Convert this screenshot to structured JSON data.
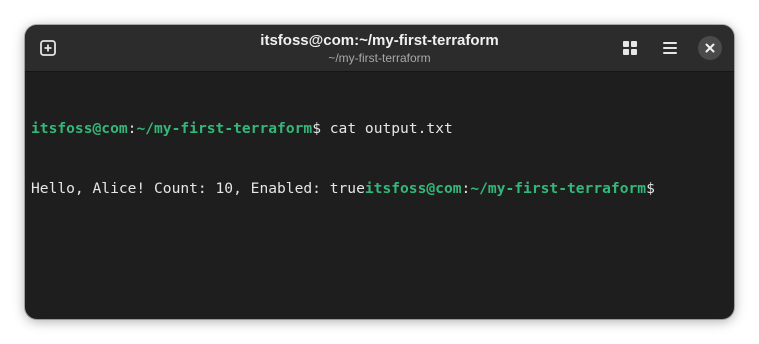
{
  "window": {
    "title": "itsfoss@com:~/my-first-terraform",
    "subtitle": "~/my-first-terraform"
  },
  "icons": {
    "new_tab": "new-tab-plus-box-icon",
    "grid": "grid-view-icon",
    "menu": "hamburger-menu-icon",
    "close": "close-x-icon"
  },
  "terminal": {
    "line1": {
      "user_host": "itsfoss@com",
      "colon": ":",
      "path": "~/my-first-terraform",
      "prompt": "$",
      "command": " cat output.txt"
    },
    "line2": {
      "output": "Hello, Alice! Count: 10, Enabled: true",
      "user_host": "itsfoss@com",
      "colon": ":",
      "path": "~/my-first-terraform",
      "prompt": "$"
    }
  },
  "colors": {
    "prompt_green": "#33b87a",
    "background": "#1e1e1e",
    "titlebar": "#2c2c2c",
    "text": "#e6e6e6"
  }
}
